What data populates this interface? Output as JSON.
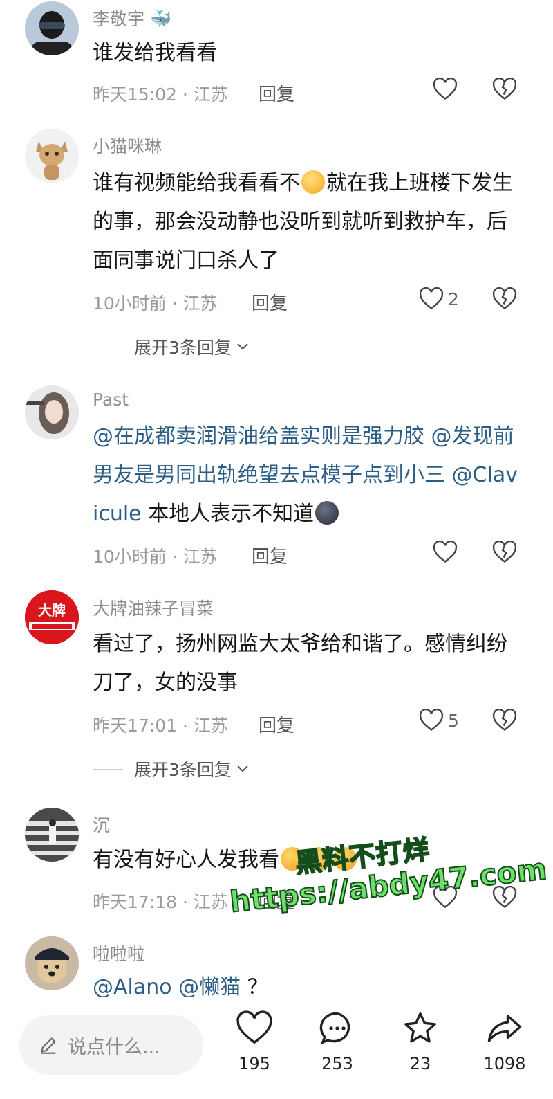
{
  "comments": [
    {
      "username": "李敬宇",
      "content_parts": [
        "谁发给我看看"
      ],
      "time": "昨天15:02 · 江苏",
      "reply": "回复",
      "likes": ""
    },
    {
      "username": "小猫咪琳",
      "content_parts": [
        "谁有视频能给我看看不",
        "就在我上班楼下发生的事，那会没动静也没听到就听到救护车，后面同事说门口杀人了"
      ],
      "time": "10小时前 · 江苏",
      "reply": "回复",
      "likes": "2",
      "expand": "展开3条回复"
    },
    {
      "username": "Past",
      "mentions": [
        "@在成都卖润滑油给盖实则是强力胶",
        "@发现前男友是男同出轨绝望去点模子点到小三",
        "@Clavicule"
      ],
      "content_tail": "本地人表示不知道",
      "time": "10小时前 · 江苏",
      "reply": "回复",
      "likes": ""
    },
    {
      "username": "大牌油辣子冒菜",
      "content_parts": [
        "看过了，扬州网监大太爷给和谐了。感情纠纷刀了，女的没事"
      ],
      "time": "昨天17:01 · 江苏",
      "reply": "回复",
      "likes": "5",
      "expand": "展开3条回复",
      "avatar_text": "大牌"
    },
    {
      "username": "沉",
      "content_parts": [
        "有没有好心人发我看"
      ],
      "time": "昨天17:18 · 江苏",
      "reply": "回复",
      "likes": ""
    },
    {
      "username": "啦啦啦",
      "mentions": [
        "@Alano",
        "@懒猫"
      ],
      "content_tail": "？"
    }
  ],
  "watermark": {
    "line1": "黑料不打烊",
    "line2": "https://abdy47.com"
  },
  "bottom_bar": {
    "input_placeholder": "说点什么...",
    "like_count": "195",
    "comment_count": "253",
    "favorite_count": "23",
    "share_count": "1098"
  },
  "colors": {
    "mention": "#2b5d86",
    "meta": "#9a9a9a",
    "watermark_fill": "#6ee06a"
  }
}
